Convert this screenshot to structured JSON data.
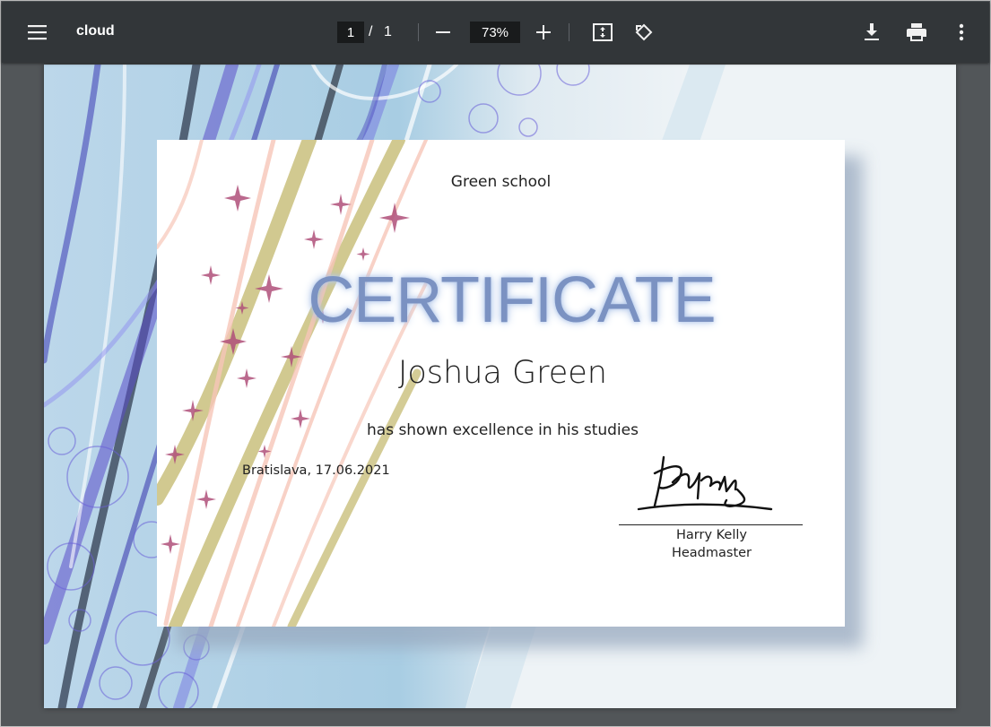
{
  "toolbar": {
    "title": "cloud",
    "page_current": "1",
    "page_separator": "/",
    "page_total": "1",
    "zoom": "73%",
    "icons": [
      "menu-icon",
      "zoom-out-icon",
      "zoom-in-icon",
      "fit-page-icon",
      "rotate-icon",
      "download-icon",
      "print-icon",
      "more-vert-icon"
    ]
  },
  "certificate": {
    "school": "Green school",
    "heading": "CERTIFICATE",
    "recipient": "Joshua Green",
    "reason": "has shown excellence in his studies",
    "place_date": "Bratislava, 17.06.2021",
    "signer_name": "Harry Kelly",
    "signer_role": "Headmaster"
  },
  "colors": {
    "toolbar_bg": "#323639",
    "viewer_bg": "#525659",
    "heading_color": "#7b92c2"
  }
}
